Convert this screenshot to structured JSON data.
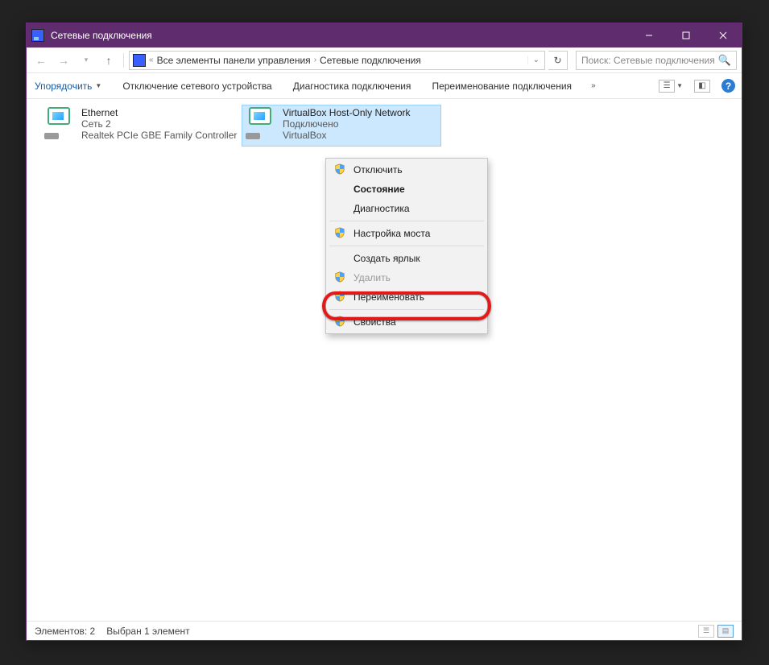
{
  "title": "Сетевые подключения",
  "breadcrumb": {
    "prefix": "«",
    "items": [
      "Все элементы панели управления",
      "Сетевые подключения"
    ]
  },
  "search": {
    "placeholder": "Поиск: Сетевые подключения"
  },
  "toolbar": {
    "organize": "Упорядочить",
    "items": [
      "Отключение сетевого устройства",
      "Диагностика подключения",
      "Переименование подключения"
    ]
  },
  "connections": [
    {
      "name": "Ethernet",
      "status": "Сеть 2",
      "detail": "Realtek PCIe GBE Family Controller",
      "selected": false
    },
    {
      "name": "VirtualBox Host-Only Network",
      "status": "Подключено",
      "detail": "VirtualBox",
      "selected": true
    }
  ],
  "context_menu": [
    {
      "label": "Отключить",
      "shield": true,
      "enabled": true,
      "bold": false
    },
    {
      "label": "Состояние",
      "shield": false,
      "enabled": true,
      "bold": true
    },
    {
      "label": "Диагностика",
      "shield": false,
      "enabled": true,
      "bold": false
    },
    {
      "sep": true
    },
    {
      "label": "Настройка моста",
      "shield": true,
      "enabled": true,
      "bold": false
    },
    {
      "sep": true
    },
    {
      "label": "Создать ярлык",
      "shield": false,
      "enabled": true,
      "bold": false
    },
    {
      "label": "Удалить",
      "shield": true,
      "enabled": false,
      "bold": false
    },
    {
      "label": "Переименовать",
      "shield": true,
      "enabled": true,
      "bold": false
    },
    {
      "sep": true
    },
    {
      "label": "Свойства",
      "shield": true,
      "enabled": true,
      "bold": false
    }
  ],
  "context_highlight_index": 9,
  "status": {
    "count_label": "Элементов: 2",
    "selection_label": "Выбран 1 элемент"
  }
}
